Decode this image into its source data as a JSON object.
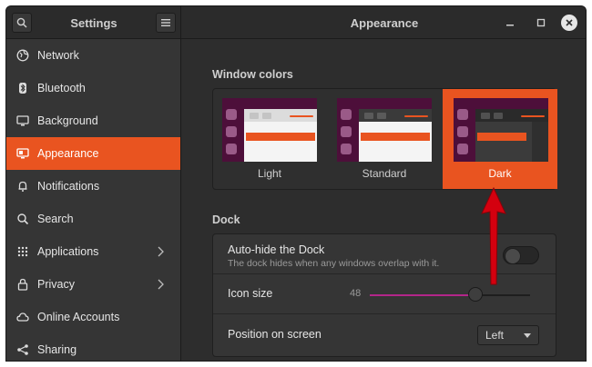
{
  "window": {
    "sidebar_title": "Settings",
    "page_title": "Appearance",
    "accent_color": "#e95420"
  },
  "sidebar": {
    "items": [
      {
        "label": "Network",
        "icon": "network-icon"
      },
      {
        "label": "Bluetooth",
        "icon": "bluetooth-icon"
      },
      {
        "label": "Background",
        "icon": "monitor-icon"
      },
      {
        "label": "Appearance",
        "icon": "appearance-icon",
        "active": true
      },
      {
        "label": "Notifications",
        "icon": "bell-icon"
      },
      {
        "label": "Search",
        "icon": "search-icon"
      },
      {
        "label": "Applications",
        "icon": "apps-grid-icon",
        "has_submenu": true
      },
      {
        "label": "Privacy",
        "icon": "lock-icon",
        "has_submenu": true
      },
      {
        "label": "Online Accounts",
        "icon": "cloud-icon"
      },
      {
        "label": "Sharing",
        "icon": "share-icon"
      }
    ]
  },
  "window_colors": {
    "title": "Window colors",
    "selected": "Dark",
    "options": [
      {
        "label": "Light"
      },
      {
        "label": "Standard"
      },
      {
        "label": "Dark"
      }
    ]
  },
  "dock": {
    "title": "Dock",
    "autohide": {
      "label": "Auto-hide the Dock",
      "description": "The dock hides when any windows overlap with it.",
      "enabled": false
    },
    "icon_size": {
      "label": "Icon size",
      "value": "48",
      "fraction": 0.66
    },
    "position": {
      "label": "Position on screen",
      "value": "Left"
    }
  }
}
